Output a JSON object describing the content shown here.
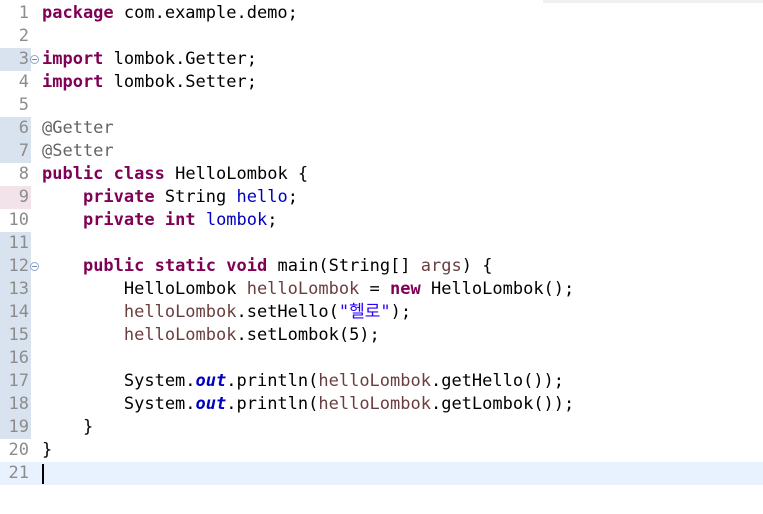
{
  "editor": {
    "lines": [
      {
        "n": "1",
        "mark": "",
        "fold": false,
        "tokens": [
          {
            "t": "package",
            "c": "kw"
          },
          {
            "t": " com.example.demo;",
            "c": ""
          }
        ]
      },
      {
        "n": "2",
        "mark": "",
        "fold": false,
        "tokens": []
      },
      {
        "n": "3",
        "mark": "blue",
        "fold": true,
        "tokens": [
          {
            "t": "import",
            "c": "kw"
          },
          {
            "t": " lombok.Getter;",
            "c": ""
          }
        ]
      },
      {
        "n": "4",
        "mark": "",
        "fold": false,
        "tokens": [
          {
            "t": "import",
            "c": "kw"
          },
          {
            "t": " lombok.Setter;",
            "c": ""
          }
        ]
      },
      {
        "n": "5",
        "mark": "",
        "fold": false,
        "tokens": []
      },
      {
        "n": "6",
        "mark": "blue",
        "fold": false,
        "tokens": [
          {
            "t": "@Getter",
            "c": "ann"
          }
        ]
      },
      {
        "n": "7",
        "mark": "blue",
        "fold": false,
        "tokens": [
          {
            "t": "@Setter",
            "c": "ann"
          }
        ]
      },
      {
        "n": "8",
        "mark": "",
        "fold": false,
        "tokens": [
          {
            "t": "public",
            "c": "kw"
          },
          {
            "t": " ",
            "c": ""
          },
          {
            "t": "class",
            "c": "kw"
          },
          {
            "t": " HelloLombok {",
            "c": ""
          }
        ]
      },
      {
        "n": "9",
        "mark": "pink",
        "fold": false,
        "tokens": [
          {
            "t": "    ",
            "c": ""
          },
          {
            "t": "private",
            "c": "kw"
          },
          {
            "t": " String ",
            "c": ""
          },
          {
            "t": "hello",
            "c": "fld"
          },
          {
            "t": ";",
            "c": ""
          }
        ]
      },
      {
        "n": "10",
        "mark": "",
        "fold": false,
        "tokens": [
          {
            "t": "    ",
            "c": ""
          },
          {
            "t": "private",
            "c": "kw"
          },
          {
            "t": " ",
            "c": ""
          },
          {
            "t": "int",
            "c": "kw"
          },
          {
            "t": " ",
            "c": ""
          },
          {
            "t": "lombok",
            "c": "fld"
          },
          {
            "t": ";",
            "c": ""
          }
        ]
      },
      {
        "n": "11",
        "mark": "blue",
        "fold": false,
        "tokens": []
      },
      {
        "n": "12",
        "mark": "blue",
        "fold": true,
        "tokens": [
          {
            "t": "    ",
            "c": ""
          },
          {
            "t": "public",
            "c": "kw"
          },
          {
            "t": " ",
            "c": ""
          },
          {
            "t": "static",
            "c": "kw"
          },
          {
            "t": " ",
            "c": ""
          },
          {
            "t": "void",
            "c": "kw"
          },
          {
            "t": " main(String[] ",
            "c": ""
          },
          {
            "t": "args",
            "c": "loc"
          },
          {
            "t": ") {",
            "c": ""
          }
        ]
      },
      {
        "n": "13",
        "mark": "blue",
        "fold": false,
        "tokens": [
          {
            "t": "        HelloLombok ",
            "c": ""
          },
          {
            "t": "helloLombok",
            "c": "loc"
          },
          {
            "t": " = ",
            "c": ""
          },
          {
            "t": "new",
            "c": "kw"
          },
          {
            "t": " HelloLombok();",
            "c": ""
          }
        ]
      },
      {
        "n": "14",
        "mark": "blue",
        "fold": false,
        "tokens": [
          {
            "t": "        ",
            "c": ""
          },
          {
            "t": "helloLombok",
            "c": "loc"
          },
          {
            "t": ".setHello(",
            "c": ""
          },
          {
            "t": "\"헬로\"",
            "c": "str"
          },
          {
            "t": ");",
            "c": ""
          }
        ]
      },
      {
        "n": "15",
        "mark": "blue",
        "fold": false,
        "tokens": [
          {
            "t": "        ",
            "c": ""
          },
          {
            "t": "helloLombok",
            "c": "loc"
          },
          {
            "t": ".setLombok(5);",
            "c": ""
          }
        ]
      },
      {
        "n": "16",
        "mark": "blue",
        "fold": false,
        "tokens": []
      },
      {
        "n": "17",
        "mark": "blue",
        "fold": false,
        "tokens": [
          {
            "t": "        System.",
            "c": ""
          },
          {
            "t": "out",
            "c": "sfld"
          },
          {
            "t": ".println(",
            "c": ""
          },
          {
            "t": "helloLombok",
            "c": "loc"
          },
          {
            "t": ".getHello());",
            "c": ""
          }
        ]
      },
      {
        "n": "18",
        "mark": "blue",
        "fold": false,
        "tokens": [
          {
            "t": "        System.",
            "c": ""
          },
          {
            "t": "out",
            "c": "sfld"
          },
          {
            "t": ".println(",
            "c": ""
          },
          {
            "t": "helloLombok",
            "c": "loc"
          },
          {
            "t": ".getLombok());",
            "c": ""
          }
        ]
      },
      {
        "n": "19",
        "mark": "blue",
        "fold": false,
        "tokens": [
          {
            "t": "    }",
            "c": ""
          }
        ]
      },
      {
        "n": "20",
        "mark": "",
        "fold": false,
        "tokens": [
          {
            "t": "}",
            "c": ""
          }
        ]
      },
      {
        "n": "21",
        "mark": "",
        "fold": false,
        "current": true,
        "caret": true,
        "tokens": []
      }
    ]
  }
}
